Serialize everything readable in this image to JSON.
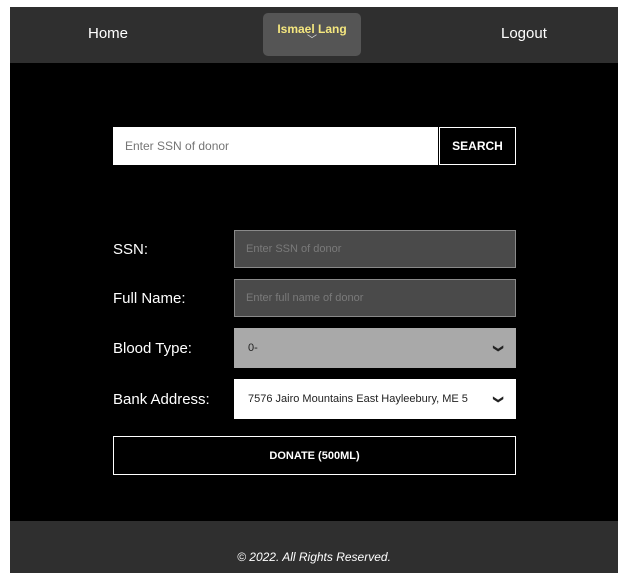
{
  "navbar": {
    "home_label": "Home",
    "user_name": "Ismael Lang",
    "user_chevron": "﹀",
    "logout_label": "Logout"
  },
  "search": {
    "placeholder": "Enter SSN of donor",
    "button_label": "SEARCH"
  },
  "form": {
    "ssn_label": "SSN:",
    "ssn_placeholder": "Enter SSN of donor",
    "fullname_label": "Full Name:",
    "fullname_placeholder": "Enter full name of donor",
    "blood_type_label": "Blood Type:",
    "blood_type_value": "0-",
    "bank_address_label": "Bank Address:",
    "bank_address_value": "7576 Jairo Mountains East Hayleebury, ME 5",
    "donate_label": "DONATE (500ML)"
  },
  "icons": {
    "select_chevron": "chevron-down-icon",
    "chevron_glyph": "❯"
  },
  "footer": {
    "text": "© 2022. All Rights Reserved."
  },
  "colors": {
    "navbar_bg": "#2f2f2f",
    "page_bg": "#000000",
    "user_name": "#f5e77f",
    "blood_select_bg": "#a9a9a9"
  }
}
